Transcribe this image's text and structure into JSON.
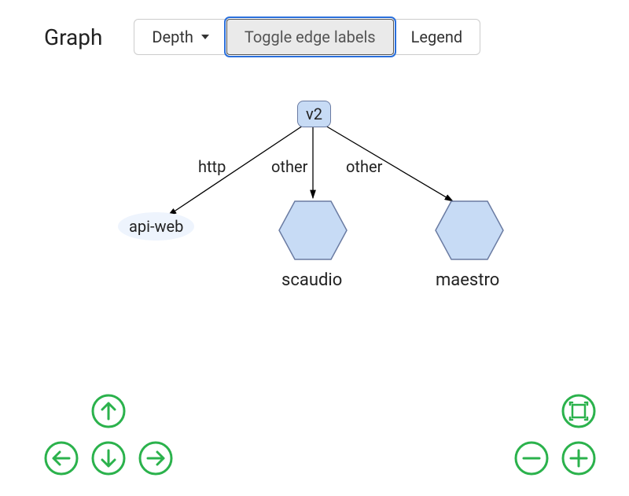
{
  "header": {
    "title": "Graph",
    "buttons": {
      "depth": "Depth",
      "toggle": "Toggle edge labels",
      "legend": "Legend"
    }
  },
  "graph": {
    "root": {
      "label": "v2"
    },
    "edges": [
      {
        "label": "http"
      },
      {
        "label": "other"
      },
      {
        "label": "other"
      }
    ],
    "nodes": {
      "api_web": "api-web",
      "scaudio": "scaudio",
      "maestro": "maestro"
    }
  },
  "controls": {
    "up": "pan-up",
    "down": "pan-down",
    "left": "pan-left",
    "right": "pan-right",
    "fit": "fit-view",
    "zoom_out": "zoom-out",
    "zoom_in": "zoom-in"
  }
}
